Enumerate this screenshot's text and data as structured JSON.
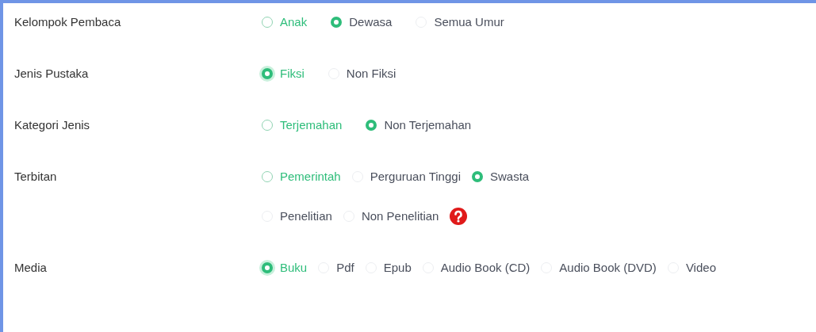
{
  "fields": [
    {
      "label": "Kelompok Pembaca",
      "lines": [
        [
          {
            "label": "Anak",
            "selected": false,
            "focused": true
          },
          {
            "label": "Dewasa",
            "selected": true,
            "focused": false
          },
          {
            "label": "Semua Umur",
            "selected": false,
            "focused": false
          }
        ]
      ]
    },
    {
      "label": "Jenis Pustaka",
      "lines": [
        [
          {
            "label": "Fiksi",
            "selected": true,
            "focused": true
          },
          {
            "label": "Non Fiksi",
            "selected": false,
            "focused": false
          }
        ]
      ]
    },
    {
      "label": "Kategori Jenis",
      "lines": [
        [
          {
            "label": "Terjemahan",
            "selected": false,
            "focused": true
          },
          {
            "label": "Non Terjemahan",
            "selected": true,
            "focused": false
          }
        ]
      ]
    },
    {
      "label": "Terbitan",
      "help_icon": true,
      "lines": [
        [
          {
            "label": "Pemerintah",
            "selected": false,
            "focused": true
          },
          {
            "label": "Perguruan Tinggi",
            "selected": false,
            "focused": false
          },
          {
            "label": "Swasta",
            "selected": true,
            "focused": false
          }
        ],
        [
          {
            "label": "Penelitian",
            "selected": false,
            "focused": false
          },
          {
            "label": "Non Penelitian",
            "selected": false,
            "focused": false
          }
        ]
      ]
    },
    {
      "label": "Media",
      "lines": [
        [
          {
            "label": "Buku",
            "selected": true,
            "focused": true
          },
          {
            "label": "Pdf",
            "selected": false,
            "focused": false
          },
          {
            "label": "Epub",
            "selected": false,
            "focused": false
          },
          {
            "label": "Audio Book (CD)",
            "selected": false,
            "focused": false
          },
          {
            "label": "Audio Book (DVD)",
            "selected": false,
            "focused": false
          },
          {
            "label": "Video",
            "selected": false,
            "focused": false
          }
        ]
      ]
    }
  ]
}
